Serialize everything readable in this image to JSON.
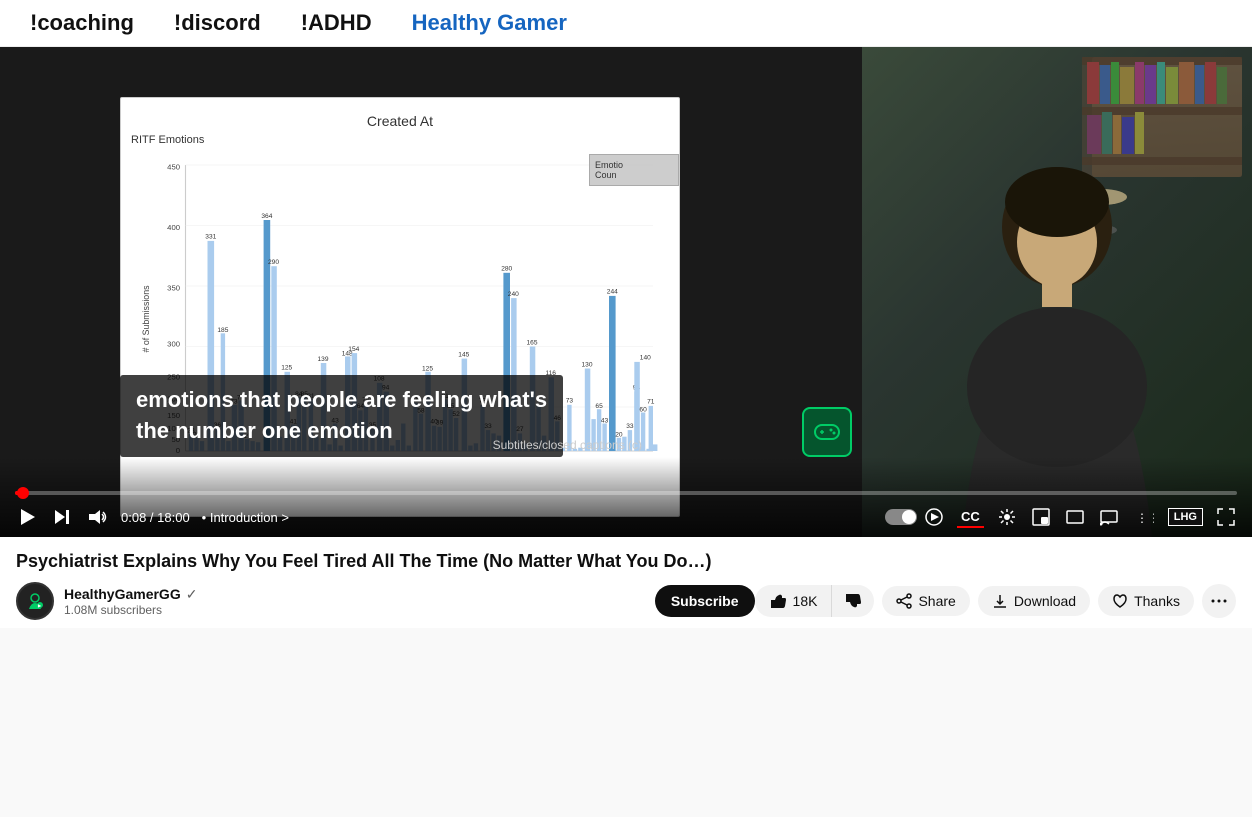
{
  "banner": {
    "items": [
      {
        "label": "!coaching",
        "highlight": false
      },
      {
        "label": "!discord",
        "highlight": false
      },
      {
        "label": "!ADHD",
        "highlight": false
      },
      {
        "label": "Healthy Gamer",
        "highlight": true
      }
    ]
  },
  "video": {
    "slide": {
      "title": "Created At",
      "subtitle": "RITF Emotions",
      "legend_line1": "Emotio",
      "legend_line2": "Coun"
    },
    "captions": "emotions that people are feeling what's\nthe number one emotion",
    "subtitles_label": "Subtitles/closed captions (c)",
    "time": "0:08 / 18:00",
    "chapter": "• Introduction >",
    "controls": {
      "play": "▶",
      "next": "⏭",
      "volume": "🔊",
      "cc": "CC",
      "settings": "⚙",
      "miniplayer": "⧉",
      "theater": "▬",
      "cast": "📺",
      "fullscreen": "⛶"
    }
  },
  "video_info": {
    "title": "Psychiatrist Explains Why You Feel Tired All The Time (No Matter What You Do…)",
    "channel_name": "HealthyGamerGG",
    "verified": true,
    "subscribers": "1.08M subscribers",
    "subscribe_label": "Subscribe",
    "actions": {
      "like_count": "18K",
      "share_label": "Share",
      "download_label": "Download",
      "thanks_label": "Thanks",
      "more_label": "···"
    }
  }
}
